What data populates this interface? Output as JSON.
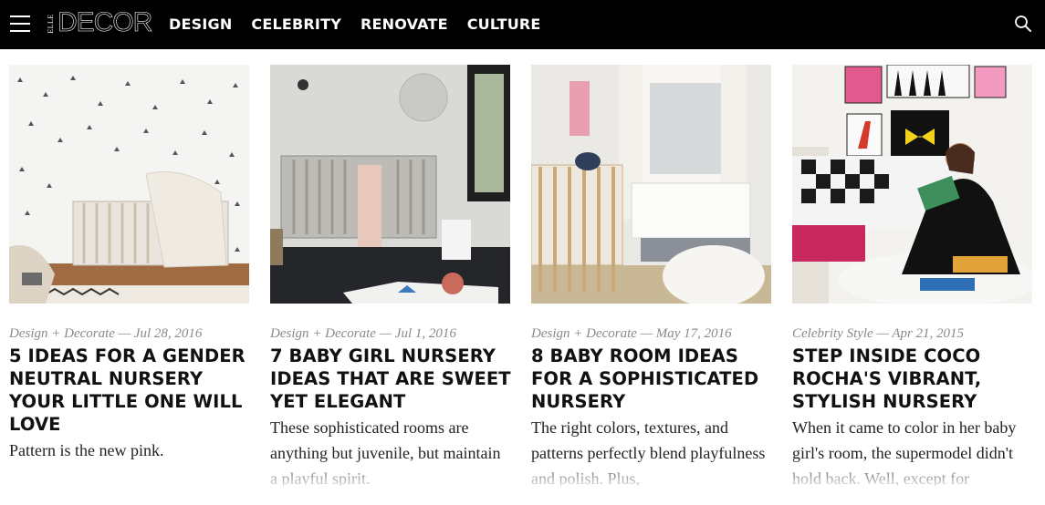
{
  "header": {
    "logo": {
      "elle": "ELLE",
      "decor": "DECOR"
    },
    "nav": [
      "DESIGN",
      "CELEBRITY",
      "RENOVATE",
      "CULTURE"
    ],
    "icons": {
      "menu": "hamburger-icon",
      "search": "search-icon"
    }
  },
  "articles": [
    {
      "category": "Design + Decorate",
      "date": "Jul 28, 2016",
      "title": "5 Ideas for a Gender Neutral Nursery Your Little One Will Love",
      "dek": "Pattern is the new pink."
    },
    {
      "category": "Design + Decorate",
      "date": "Jul 1, 2016",
      "title": "7 Baby Girl Nursery Ideas That Are Sweet Yet Elegant",
      "dek": "These sophisticated rooms are anything but juvenile, but maintain a playful spirit."
    },
    {
      "category": "Design + Decorate",
      "date": "May 17, 2016",
      "title": "8 Baby Room Ideas for a Sophisticated Nursery",
      "dek": "The right colors, textures, and patterns perfectly blend playfulness and polish. Plus,"
    },
    {
      "category": "Celebrity Style",
      "date": "Apr 21, 2015",
      "title": "Step Inside Coco Rocha's Vibrant, Stylish Nursery",
      "dek": "When it came to color in her baby girl's room, the supermodel didn't hold back. Well, except for"
    }
  ],
  "meta_separator": "—",
  "colors": {
    "header_bg": "#000000",
    "meta_gray": "#8a8a8a",
    "text": "#111111"
  }
}
